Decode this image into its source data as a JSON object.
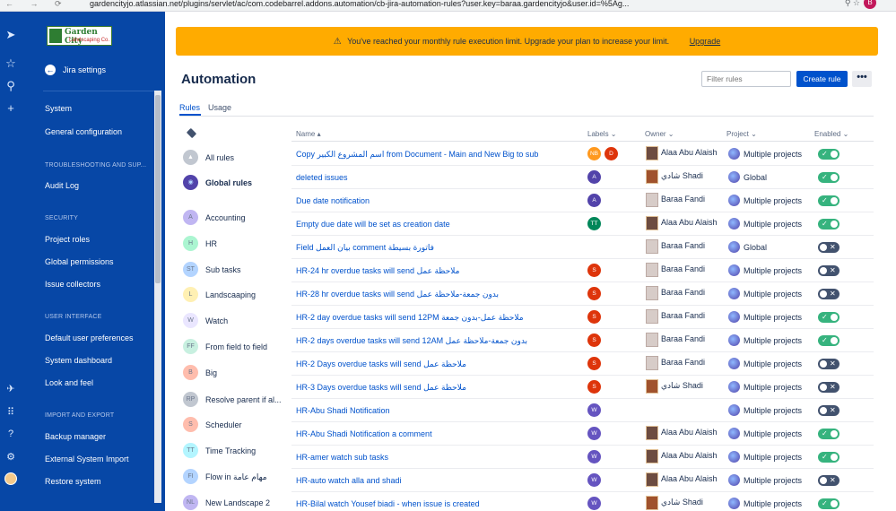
{
  "browser": {
    "url": "gardencityjo.atlassian.net/plugins/servlet/ac/com.codebarrel.addons.automation/cb-jira-automation-rules?user.key=baraa.gardencityjo&user.id=%5Ag..."
  },
  "logo": {
    "name": "Garden City",
    "tagline": "Landscaping Co."
  },
  "sidebar": {
    "back_label": "Jira settings",
    "items_top": [
      "System",
      "General configuration"
    ],
    "sections": [
      {
        "title": "TROUBLESHOOTING AND SUP...",
        "items": [
          "Audit Log"
        ]
      },
      {
        "title": "SECURITY",
        "items": [
          "Project roles",
          "Global permissions",
          "Issue collectors"
        ]
      },
      {
        "title": "USER INTERFACE",
        "items": [
          "Default user preferences",
          "System dashboard",
          "Look and feel"
        ]
      },
      {
        "title": "IMPORT AND EXPORT",
        "items": [
          "Backup manager",
          "External System Import",
          "Restore system"
        ]
      }
    ]
  },
  "banner": {
    "text": "You've reached your monthly rule execution limit. Upgrade your plan to increase your limit.",
    "link": "Upgrade"
  },
  "page": {
    "title": "Automation",
    "filter_placeholder": "Filter rules",
    "create_label": "Create rule",
    "more_label": "•••"
  },
  "tabs": [
    "Rules",
    "Usage"
  ],
  "labels": [
    {
      "letter": "",
      "name": "All rules",
      "color": "#c1c7d0",
      "bold": false
    },
    {
      "letter": "",
      "name": "Global rules",
      "color": "#5243aa",
      "bold": true
    },
    {
      "letter": "A",
      "name": "Accounting",
      "color": "#c0b6f2"
    },
    {
      "letter": "H",
      "name": "HR",
      "color": "#abf5d1"
    },
    {
      "letter": "ST",
      "name": "Sub tasks",
      "color": "#b3d4ff"
    },
    {
      "letter": "L",
      "name": "Landscaaping",
      "color": "#fff0b3"
    },
    {
      "letter": "W",
      "name": "Watch",
      "color": "#eae6ff"
    },
    {
      "letter": "FF",
      "name": "From field to field",
      "color": "#c8f0e0"
    },
    {
      "letter": "B",
      "name": "Big",
      "color": "#ffbdad"
    },
    {
      "letter": "RP",
      "name": "Resolve parent if al...",
      "color": "#c1c7d0"
    },
    {
      "letter": "S",
      "name": "Scheduler",
      "color": "#ffbdad"
    },
    {
      "letter": "TT",
      "name": "Time Tracking",
      "color": "#b3f5ff"
    },
    {
      "letter": "FI",
      "name": "Flow in مهام عامة",
      "color": "#b3d4ff"
    },
    {
      "letter": "NL",
      "name": "New Landscape 2",
      "color": "#c0b6f2"
    }
  ],
  "columns": {
    "name": "Name ▴",
    "labels": "Labels ⌄",
    "owner": "Owner ⌄",
    "project": "Project ⌄",
    "enabled": "Enabled ⌄"
  },
  "rules": [
    {
      "name": "Copy اسم المشروع الكبير from Document - Main and New Big to sub",
      "badges": [
        {
          "t": "NB",
          "c": "#ff991f"
        },
        {
          "t": "D",
          "c": "#de350b"
        }
      ],
      "owner": "Alaa Abu Alaish",
      "av": "alaa",
      "project": "Multiple projects",
      "on": true
    },
    {
      "name": "deleted issues",
      "badges": [
        {
          "t": "A",
          "c": "#5243aa"
        }
      ],
      "owner": "شادي Shadi",
      "av": "shadi",
      "project": "Global",
      "on": true
    },
    {
      "name": "Due date notification",
      "badges": [
        {
          "t": "A",
          "c": "#5243aa"
        }
      ],
      "owner": "Baraa Fandi",
      "av": "baraa",
      "project": "Multiple projects",
      "on": true
    },
    {
      "name": "Empty due date will be set as creation date",
      "badges": [
        {
          "t": "TT",
          "c": "#00875a"
        }
      ],
      "owner": "Alaa Abu Alaish",
      "av": "alaa",
      "project": "Multiple projects",
      "on": true
    },
    {
      "name": "Field بيان العمل comment فاتورة بسيطة",
      "badges": [],
      "owner": "Baraa Fandi",
      "av": "baraa",
      "project": "Global",
      "on": false
    },
    {
      "name": "HR-24 hr overdue tasks will send ملاحظة عمل",
      "badges": [
        {
          "t": "S",
          "c": "#de350b"
        }
      ],
      "owner": "Baraa Fandi",
      "av": "baraa",
      "project": "Multiple projects",
      "on": false
    },
    {
      "name": "HR-28 hr overdue tasks will send بدون جمعة-ملاحظة عمل",
      "badges": [
        {
          "t": "S",
          "c": "#de350b"
        }
      ],
      "owner": "Baraa Fandi",
      "av": "baraa",
      "project": "Multiple projects",
      "on": false
    },
    {
      "name": "HR-2 day overdue tasks will send 12PM ملاحظة عمل-بدون جمعة",
      "badges": [
        {
          "t": "S",
          "c": "#de350b"
        }
      ],
      "owner": "Baraa Fandi",
      "av": "baraa",
      "project": "Multiple projects",
      "on": true
    },
    {
      "name": "HR-2 days overdue tasks will send 12AM بدون جمعة-ملاحظة عمل",
      "badges": [
        {
          "t": "S",
          "c": "#de350b"
        }
      ],
      "owner": "Baraa Fandi",
      "av": "baraa",
      "project": "Multiple projects",
      "on": true
    },
    {
      "name": "HR-2 Days overdue tasks will send ملاحظة عمل",
      "badges": [
        {
          "t": "S",
          "c": "#de350b"
        }
      ],
      "owner": "Baraa Fandi",
      "av": "baraa",
      "project": "Multiple projects",
      "on": false
    },
    {
      "name": "HR-3 Days overdue tasks will send ملاحظة عمل",
      "badges": [
        {
          "t": "S",
          "c": "#de350b"
        }
      ],
      "owner": "شادي Shadi",
      "av": "shadi",
      "project": "Multiple projects",
      "on": false
    },
    {
      "name": "HR-Abu Shadi Notification",
      "badges": [
        {
          "t": "W",
          "c": "#6554c0"
        }
      ],
      "owner": "",
      "av": "",
      "project": "Multiple projects",
      "on": false
    },
    {
      "name": "HR-Abu Shadi Notification a comment",
      "badges": [
        {
          "t": "W",
          "c": "#6554c0"
        }
      ],
      "owner": "Alaa Abu Alaish",
      "av": "alaa",
      "project": "Multiple projects",
      "on": true
    },
    {
      "name": "HR-amer watch sub tasks",
      "badges": [
        {
          "t": "W",
          "c": "#6554c0"
        }
      ],
      "owner": "Alaa Abu Alaish",
      "av": "alaa",
      "project": "Multiple projects",
      "on": true
    },
    {
      "name": "HR-auto watch alla and shadi",
      "badges": [
        {
          "t": "W",
          "c": "#6554c0"
        }
      ],
      "owner": "Alaa Abu Alaish",
      "av": "alaa",
      "project": "Multiple projects",
      "on": false
    },
    {
      "name": "HR-Bilal watch Yousef biadi - when issue is created",
      "badges": [
        {
          "t": "W",
          "c": "#6554c0"
        }
      ],
      "owner": "شادي Shadi",
      "av": "shadi",
      "project": "Multiple projects",
      "on": true
    }
  ]
}
